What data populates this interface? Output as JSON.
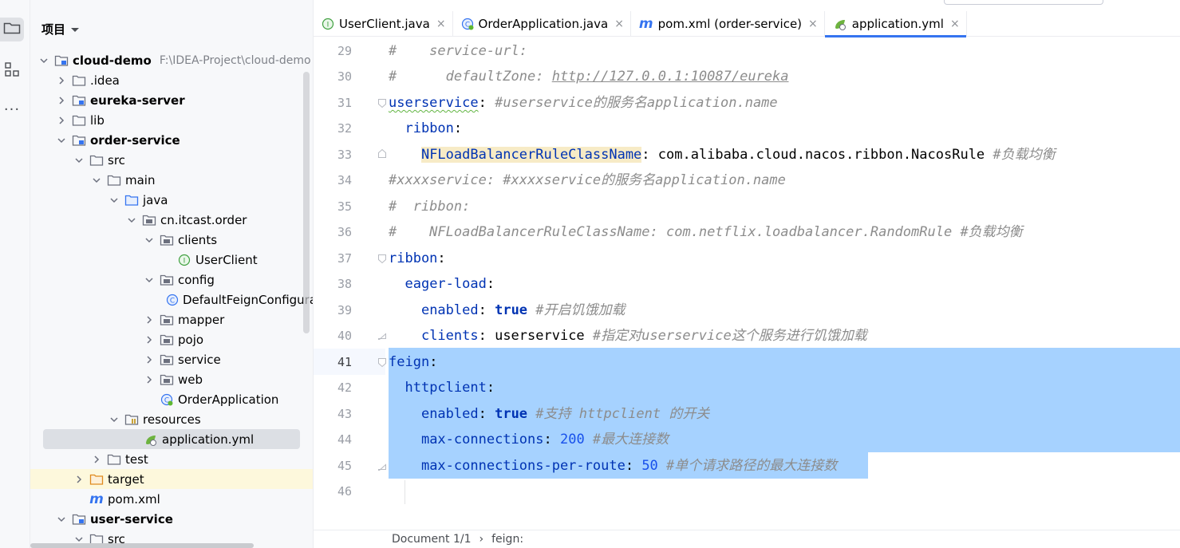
{
  "sidebar": {
    "project_label": "项目",
    "dots": "···"
  },
  "tree": [
    {
      "label": "cloud-demo",
      "path": "F:\\IDEA-Project\\cloud-demo",
      "bold": true
    },
    {
      "label": ".idea"
    },
    {
      "label": "eureka-server",
      "bold": true
    },
    {
      "label": "lib"
    },
    {
      "label": "order-service",
      "bold": true
    },
    {
      "label": "src"
    },
    {
      "label": "main"
    },
    {
      "label": "java"
    },
    {
      "label": "cn.itcast.order"
    },
    {
      "label": "clients"
    },
    {
      "label": "UserClient"
    },
    {
      "label": "config"
    },
    {
      "label": "DefaultFeignConfiguration"
    },
    {
      "label": "mapper"
    },
    {
      "label": "pojo"
    },
    {
      "label": "service"
    },
    {
      "label": "web"
    },
    {
      "label": "OrderApplication"
    },
    {
      "label": "resources"
    },
    {
      "label": "application.yml"
    },
    {
      "label": "test"
    },
    {
      "label": "target"
    },
    {
      "label": "pom.xml"
    },
    {
      "label": "user-service",
      "bold": true
    },
    {
      "label": "src"
    }
  ],
  "tabs": [
    {
      "label": "UserClient.java",
      "close": "×"
    },
    {
      "label": "OrderApplication.java",
      "close": "×"
    },
    {
      "label": "pom.xml (order-service)",
      "close": "×"
    },
    {
      "label": "application.yml",
      "close": "×"
    }
  ],
  "line_numbers": [
    "29",
    "30",
    "31",
    "32",
    "33",
    "34",
    "35",
    "36",
    "37",
    "38",
    "39",
    "40",
    "41",
    "42",
    "43",
    "44",
    "45",
    "46"
  ],
  "code": {
    "l29": "#    service-url:",
    "l30a": "#      defaultZone: ",
    "l30b": "http://127.0.0.1:10087/eureka",
    "l31a": "userservice",
    "l31b": ": ",
    "l31c": "#userservice的服务名application.name",
    "l32a": "  ",
    "l32b": "ribbon",
    "l32c": ":",
    "l33a": "    ",
    "l33b": "NFLoadBalancerRuleClassName",
    "l33c": ": com.alibaba.cloud.nacos.ribbon.NacosRule ",
    "l33d": "#负载均衡",
    "l34": "#xxxxservice: #xxxxservice的服务名application.name",
    "l35": "#  ribbon:",
    "l36": "#    NFLoadBalancerRuleClassName: com.netflix.loadbalancer.RandomRule #负载均衡",
    "l37a": "ribbon",
    "l37b": ":",
    "l38a": "  ",
    "l38b": "eager-load",
    "l38c": ":",
    "l39a": "    ",
    "l39b": "enabled",
    "l39c": ": ",
    "l39d": "true",
    "l39e": " #开启饥饿加载",
    "l40a": "    ",
    "l40b": "clients",
    "l40c": ": userservice ",
    "l40d": "#指定对userservice这个服务进行饥饿加载",
    "l41a": "feign",
    "l41b": ":",
    "l42a": "  ",
    "l42b": "httpclient",
    "l42c": ":",
    "l43a": "    ",
    "l43b": "enabled",
    "l43c": ": ",
    "l43d": "true",
    "l43e": " #支持 httpclient 的开关",
    "l44a": "    ",
    "l44b": "max-connections",
    "l44c": ": ",
    "l44d": "200",
    "l44e": " #最大连接数",
    "l45a": "    ",
    "l45b": "max-connections-per-route",
    "l45c": ": ",
    "l45d": "50",
    "l45e": " #单个请求路径的最大连接数"
  },
  "breadcrumb": {
    "doc": "Document 1/1",
    "sep": "›",
    "node": "feign:"
  },
  "colors": {
    "selection": "#a6d2ff",
    "key": "#0033b3",
    "comment": "#8c8c8c",
    "number": "#1750eb",
    "accent": "#3574f0"
  }
}
